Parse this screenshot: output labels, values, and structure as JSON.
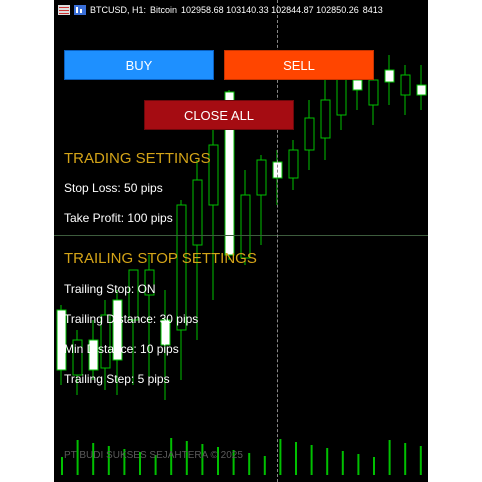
{
  "header": {
    "symbol": "BTCUSD, H1:",
    "description": "Bitcoin",
    "prices": "102958.68 103140.33 102844.87 102850.26",
    "volume": "8413"
  },
  "buttons": {
    "buy": "BUY",
    "sell": "SELL",
    "close_all": "CLOSE ALL"
  },
  "trading_settings": {
    "title": "TRADING SETTINGS",
    "stop_loss": "Stop Loss: 50 pips",
    "take_profit": "Take Profit: 100 pips"
  },
  "trailing_settings": {
    "title": "TRAILING STOP SETTINGS",
    "trailing_stop": "Trailing Stop: ON",
    "trailing_distance": "Trailing Distance: 30 pips",
    "min_distance": "Min Distance: 10 pips",
    "trailing_step": "Trailing Step: 5 pips"
  },
  "watermark": "PT BUDI SUKSES SEJAHTERA © 2025",
  "colors": {
    "buy": "#1e90ff",
    "sell": "#ff4500",
    "close_all": "#a50c12",
    "section_title": "#d4a418",
    "bull_candle": "#ffffff",
    "bear_candle": "#000000",
    "wick": "#00c000",
    "volume": "#00c000"
  }
}
